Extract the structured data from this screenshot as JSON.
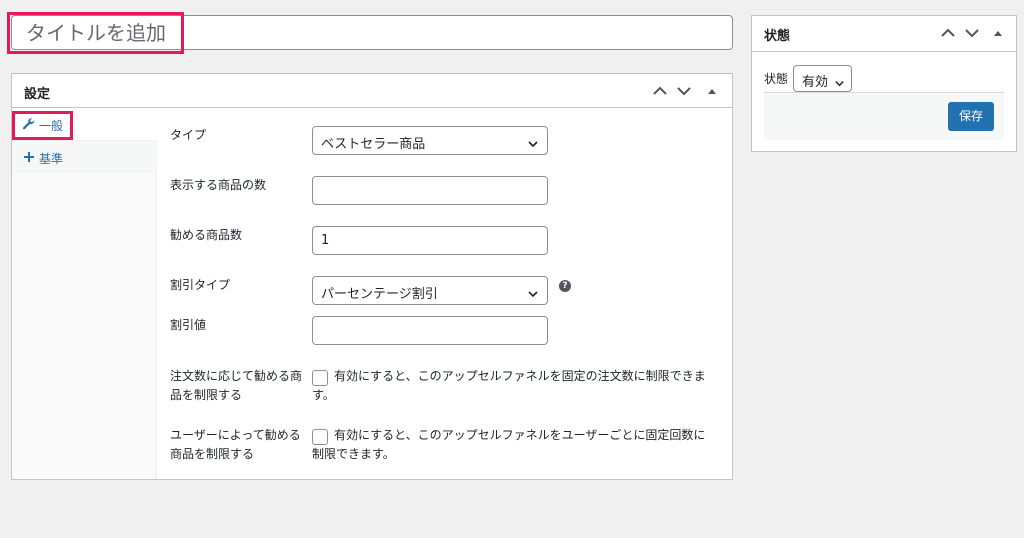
{
  "title_field": {
    "placeholder": "タイトルを追加"
  },
  "settings": {
    "title": "設定",
    "tabs": [
      {
        "label": "一般",
        "icon": "wrench-icon"
      },
      {
        "label": "基準",
        "icon": "plus-icon"
      }
    ],
    "fields": {
      "type": {
        "label": "タイプ",
        "value": "ベストセラー商品"
      },
      "product_count": {
        "label": "表示する商品の数",
        "value": ""
      },
      "recommend_count": {
        "label": "勧める商品数",
        "value": "1"
      },
      "discount_type": {
        "label": "割引タイプ",
        "value": "パーセンテージ割引",
        "help": "?"
      },
      "discount_value": {
        "label": "割引値",
        "value": ""
      },
      "limit_by_orders": {
        "label": "注文数に応じて勧める商品を制限する",
        "description": "有効にすると、このアップセルファネルを固定の注文数に制限できます。",
        "checked": false
      },
      "limit_by_user": {
        "label": "ユーザーによって勧める商品を制限する",
        "description": "有効にすると、このアップセルファネルをユーザーごとに固定回数に制限できます。",
        "checked": false
      }
    }
  },
  "status_box": {
    "title": "状態",
    "field_label": "状態",
    "value": "有効",
    "save_label": "保存"
  },
  "colors": {
    "accent": "#2271b1",
    "highlight": "#e4195a",
    "background": "#f0f0f1"
  }
}
